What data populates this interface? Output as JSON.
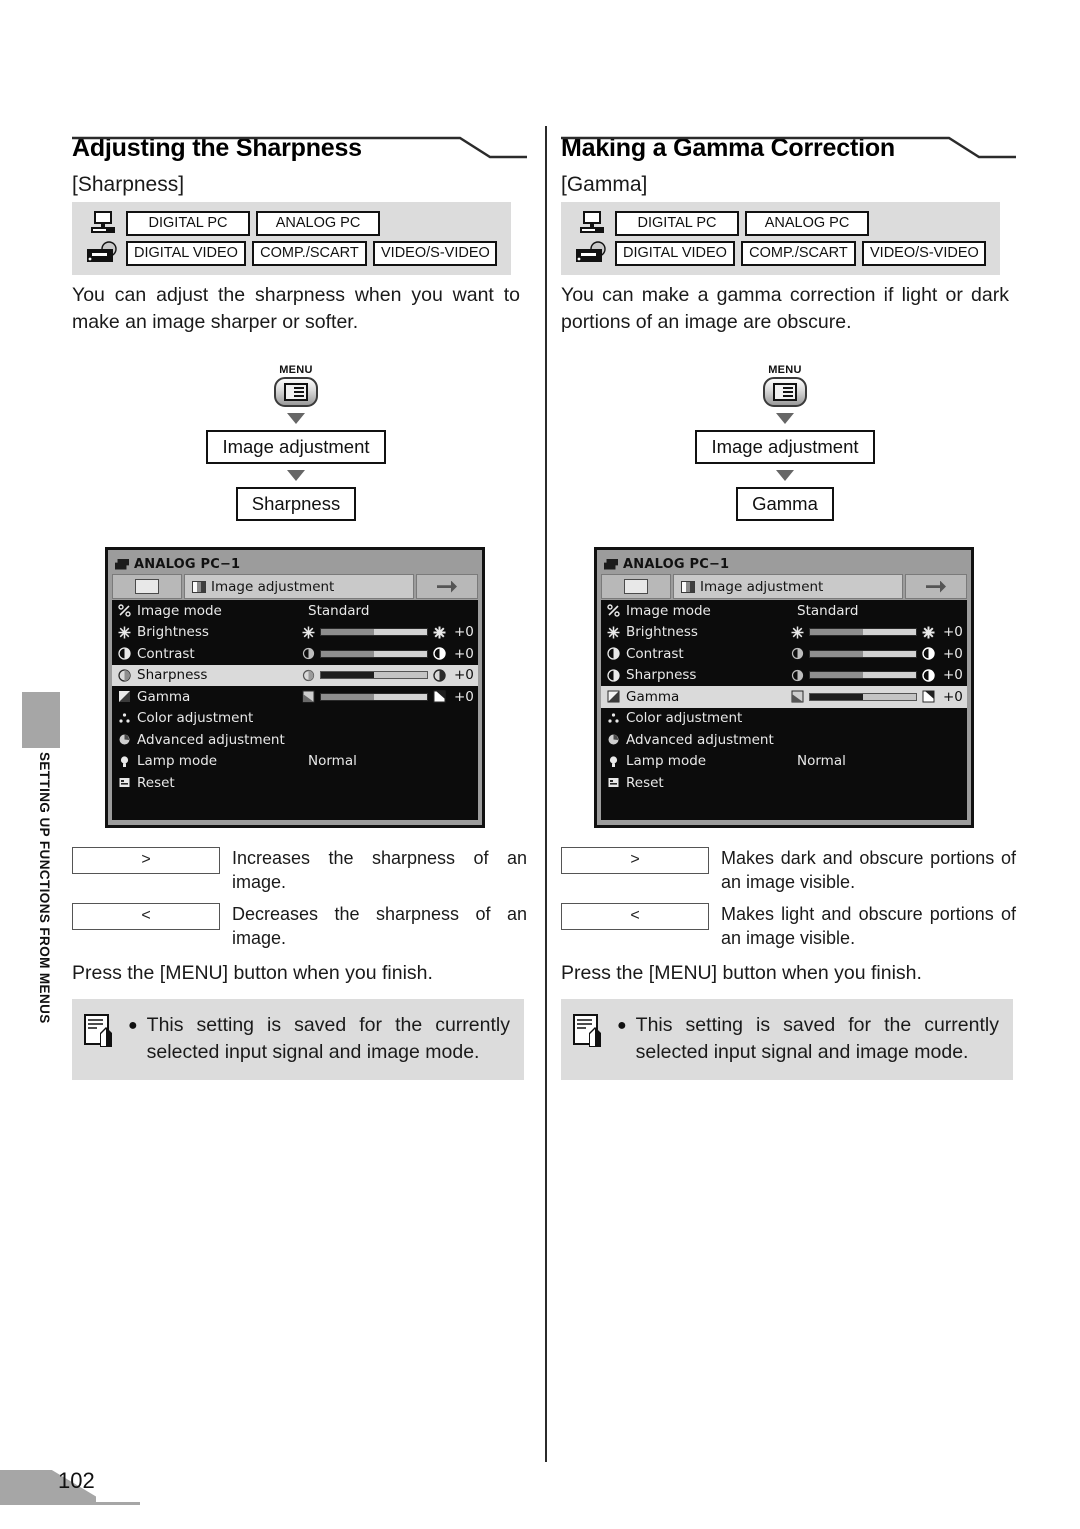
{
  "page": {
    "number": "102",
    "side_tab_label": "SETTING UP FUNCTIONS FROM MENUS"
  },
  "columns": [
    {
      "id": "sharpness",
      "title": "Adjusting the Sharpness",
      "subtitle": "[Sharpness]",
      "signals": {
        "pc_row": [
          "DIGITAL PC",
          "ANALOG PC"
        ],
        "video_row": [
          "DIGITAL VIDEO",
          "COMP./SCART",
          "VIDEO/S-VIDEO"
        ]
      },
      "intro": "You can adjust the sharpness when you want to make an image sharper or softer.",
      "flow": {
        "menu_caption": "MENU",
        "step1": "Image adjustment",
        "step2": "Sharpness"
      },
      "osd": {
        "signal_title": "ANALOG PC−1",
        "tab_label": "Image adjustment",
        "selected_row": "Sharpness",
        "rows": [
          {
            "label": "Image mode",
            "value": "Standard",
            "type": "value",
            "icon": "image-mode-icon"
          },
          {
            "label": "Brightness",
            "value": "+0",
            "type": "slider",
            "icon": "brightness-icon"
          },
          {
            "label": "Contrast",
            "value": "+0",
            "type": "slider",
            "icon": "contrast-icon"
          },
          {
            "label": "Sharpness",
            "value": "+0",
            "type": "slider",
            "icon": "sharpness-icon"
          },
          {
            "label": "Gamma",
            "value": "+0",
            "type": "slider",
            "icon": "gamma-icon"
          },
          {
            "label": "Color adjustment",
            "value": "",
            "type": "plain",
            "icon": "color-adjustment-icon"
          },
          {
            "label": "Advanced adjustment",
            "value": "",
            "type": "plain",
            "icon": "advanced-adjustment-icon"
          },
          {
            "label": "Lamp mode",
            "value": "Normal",
            "type": "value",
            "icon": "lamp-mode-icon"
          },
          {
            "label": "Reset",
            "value": "",
            "type": "plain",
            "icon": "reset-icon"
          }
        ]
      },
      "keys": [
        {
          "key": ">",
          "desc": "Increases the sharpness of an image."
        },
        {
          "key": "<",
          "desc": "Decreases the sharpness of an image."
        }
      ],
      "press_line": "Press the [MENU] button when you finish.",
      "note": "This setting is saved for the currently selected input signal and image mode."
    },
    {
      "id": "gamma",
      "title": "Making a Gamma Correction",
      "subtitle": "[Gamma]",
      "signals": {
        "pc_row": [
          "DIGITAL PC",
          "ANALOG PC"
        ],
        "video_row": [
          "DIGITAL VIDEO",
          "COMP./SCART",
          "VIDEO/S-VIDEO"
        ]
      },
      "intro": "You can make a gamma correction if light or dark portions of an image are obscure.",
      "flow": {
        "menu_caption": "MENU",
        "step1": "Image adjustment",
        "step2": "Gamma"
      },
      "osd": {
        "signal_title": "ANALOG PC−1",
        "tab_label": "Image adjustment",
        "selected_row": "Gamma",
        "rows": [
          {
            "label": "Image mode",
            "value": "Standard",
            "type": "value",
            "icon": "image-mode-icon"
          },
          {
            "label": "Brightness",
            "value": "+0",
            "type": "slider",
            "icon": "brightness-icon"
          },
          {
            "label": "Contrast",
            "value": "+0",
            "type": "slider",
            "icon": "contrast-icon"
          },
          {
            "label": "Sharpness",
            "value": "+0",
            "type": "slider",
            "icon": "sharpness-icon"
          },
          {
            "label": "Gamma",
            "value": "+0",
            "type": "slider",
            "icon": "gamma-icon"
          },
          {
            "label": "Color adjustment",
            "value": "",
            "type": "plain",
            "icon": "color-adjustment-icon"
          },
          {
            "label": "Advanced adjustment",
            "value": "",
            "type": "plain",
            "icon": "advanced-adjustment-icon"
          },
          {
            "label": "Lamp mode",
            "value": "Normal",
            "type": "value",
            "icon": "lamp-mode-icon"
          },
          {
            "label": "Reset",
            "value": "",
            "type": "plain",
            "icon": "reset-icon"
          }
        ]
      },
      "keys": [
        {
          "key": ">",
          "desc": "Makes dark and obscure portions of an image visible."
        },
        {
          "key": "<",
          "desc": "Makes light and obscure portions of an image visible."
        }
      ],
      "press_line": "Press the [MENU] button when you finish.",
      "note": "This setting is saved for the currently selected input signal and image mode."
    }
  ],
  "colors": {
    "panel_gray": "#dcdcdc",
    "tab_gray": "#a6a6a6",
    "osd_bg": "#0c0c0c",
    "osd_selected": "#dadada"
  }
}
